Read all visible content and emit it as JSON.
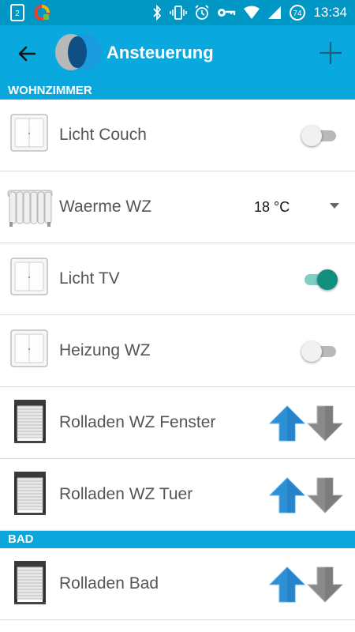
{
  "status_bar": {
    "time": "13:34",
    "battery_level": "74",
    "notification_badge": "2",
    "icons": [
      "notification-icon",
      "app-icon",
      "bluetooth-icon",
      "vibrate-icon",
      "alarm-icon",
      "key-icon",
      "wifi-icon",
      "battery-icon"
    ]
  },
  "toolbar": {
    "title": "Ansteuerung",
    "back_icon": "back-arrow-icon",
    "add_icon": "plus-icon"
  },
  "colors": {
    "status_bar": "#0097c4",
    "toolbar": "#09a8de",
    "section_header": "#0aa6dc",
    "switch_on_thumb": "#128f7f",
    "switch_on_track": "#7fcfc4",
    "arrow_up": "#2d8fd6",
    "arrow_down": "#8a8a8a"
  },
  "sections": [
    {
      "title": "WOHNZIMMER",
      "items": [
        {
          "label": "Licht Couch",
          "icon": "light-switch-icon",
          "control": "switch",
          "on": false
        },
        {
          "label": "Waerme WZ",
          "icon": "radiator-icon",
          "control": "temperature",
          "value": "18 °C"
        },
        {
          "label": "Licht TV",
          "icon": "light-switch-icon",
          "control": "switch",
          "on": true
        },
        {
          "label": "Heizung WZ",
          "icon": "light-switch-icon",
          "control": "switch",
          "on": false
        },
        {
          "label": "Rolladen WZ Fenster",
          "icon": "roller-shutter-icon",
          "control": "updown"
        },
        {
          "label": "Rolladen WZ Tuer",
          "icon": "roller-shutter-icon",
          "control": "updown"
        }
      ]
    },
    {
      "title": "BAD",
      "items": [
        {
          "label": "Rolladen Bad",
          "icon": "roller-shutter-icon",
          "control": "updown"
        }
      ]
    }
  ]
}
